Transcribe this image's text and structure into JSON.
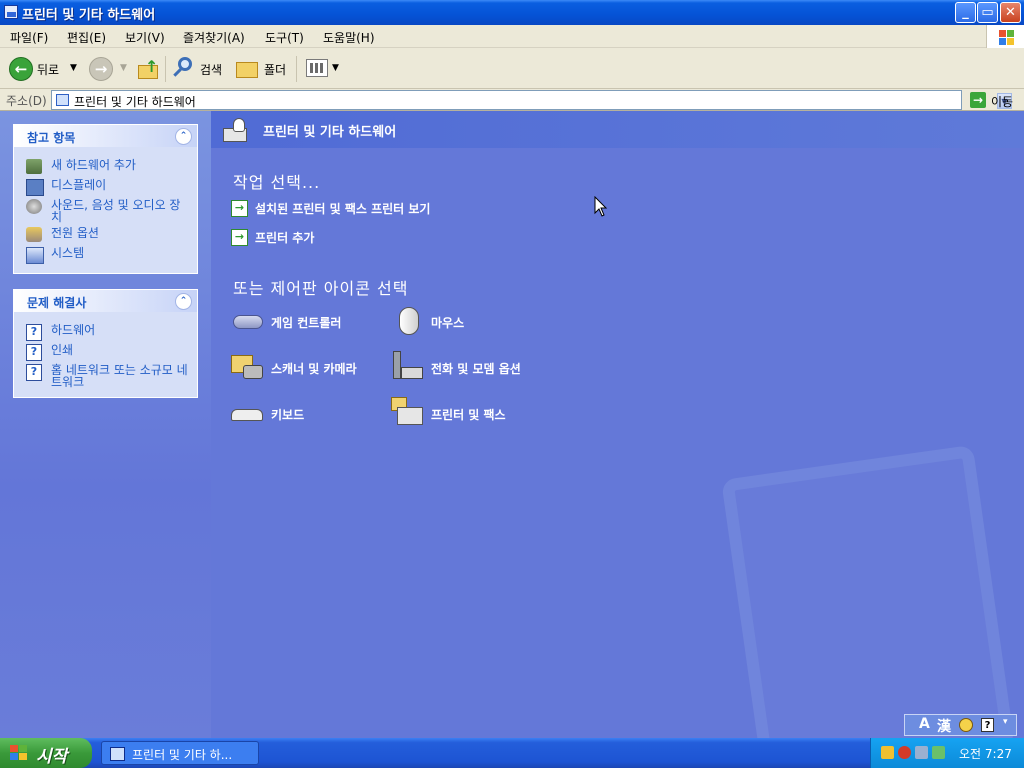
{
  "window": {
    "title": "프린터 및 기타 하드웨어",
    "controls": {
      "minimize": "_",
      "maximize": "▭",
      "close": "✕"
    }
  },
  "menu": [
    "파일(F)",
    "편집(E)",
    "보기(V)",
    "즐겨찾기(A)",
    "도구(T)",
    "도움말(H)"
  ],
  "toolbar": {
    "back_label": "뒤로",
    "search_label": "검색",
    "folders_label": "폴더"
  },
  "address": {
    "label": "주소(D)",
    "value": "프린터 및 기타 하드웨어",
    "go_label": "이동"
  },
  "see_also": {
    "title": "참고 항목",
    "items": [
      "새 하드웨어 추가",
      "디스플레이",
      "사운드, 음성 및 오디오 장치",
      "전원 옵션",
      "시스템"
    ]
  },
  "troubleshooters": {
    "title": "문제 해결사",
    "items": [
      "하드웨어",
      "인쇄",
      "홈 네트워크 또는 소규모 네트워크"
    ]
  },
  "content": {
    "header_title": "프린터 및 기타 하드웨어",
    "task_heading": "작업 선택...",
    "tasks": [
      "설치된 프린터 및 팩스 프린터 보기",
      "프린터 추가"
    ],
    "icon_heading": "또는 제어판 아이콘 선택",
    "icons": [
      "게임 컨트롤러",
      "마우스",
      "스캐너 및 카메라",
      "전화 및 모뎀 옵션",
      "키보드",
      "프린터 및 팩스"
    ]
  },
  "taskbar": {
    "start_label": "시작",
    "task_button": "프린터 및 기타 하...",
    "clock": "오전 7:27"
  },
  "langbar": {
    "mode": "A",
    "hanja": "漢"
  },
  "colors": {
    "title_blue": "#0553d6",
    "pane_blue": "#6478d8",
    "link_blue": "#215dc6",
    "start_green": "#3a9a3a"
  }
}
